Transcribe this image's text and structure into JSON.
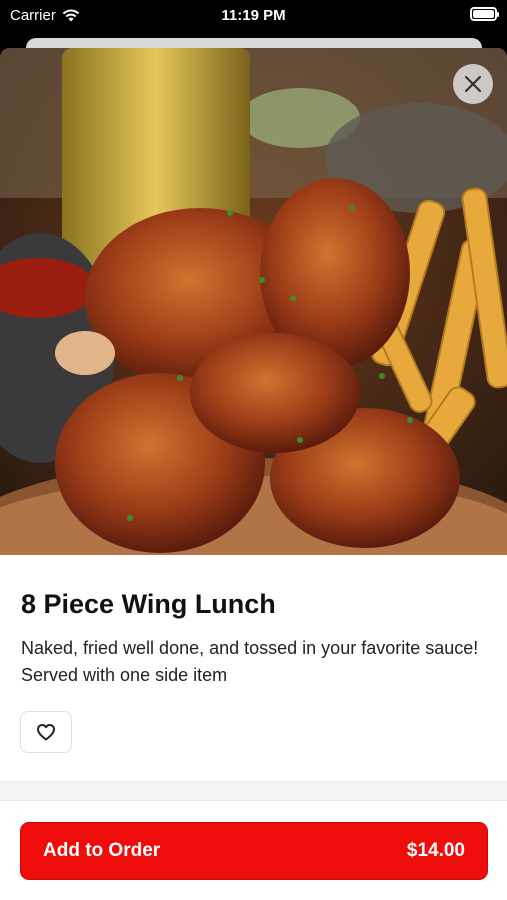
{
  "status_bar": {
    "carrier": "Carrier",
    "time": "11:19 PM"
  },
  "item": {
    "name": "8 Piece Wing Lunch",
    "description": "Naked, fried well done, and tossed in your favorite sauce! Served with one side item",
    "price": "$14.00"
  },
  "actions": {
    "add_to_order": "Add to Order"
  },
  "icons": {
    "close": "close-icon",
    "favorite": "heart-icon",
    "wifi": "wifi-icon",
    "battery": "battery-icon"
  },
  "colors": {
    "accent": "#ee0d0a",
    "background": "#ffffff"
  }
}
